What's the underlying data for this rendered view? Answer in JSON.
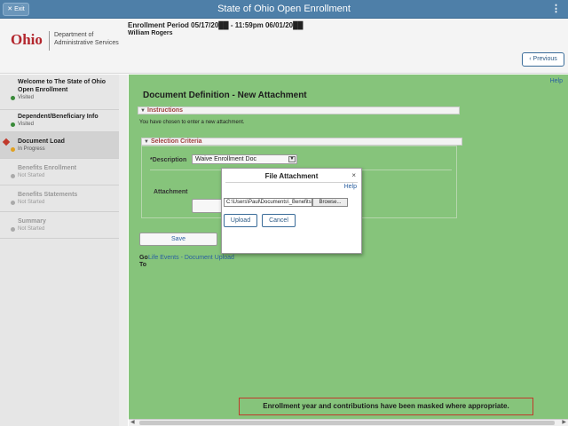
{
  "topbar": {
    "exit_label": "Exit",
    "exit_icon": "close-icon",
    "title": "State of Ohio Open Enrollment",
    "menu_icon": "vertical-ellipsis-icon"
  },
  "header": {
    "logo_word": "Ohio",
    "logo_dept_line1": "Department of",
    "logo_dept_line2": "Administrative Services",
    "enrollment_period": "Enrollment Period 05/17/20██ - 11:59pm 06/01/20██",
    "member_name": "William Rogers",
    "previous_label": "Previous",
    "previous_icon": "chevron-left-icon"
  },
  "sidebar": {
    "items": [
      {
        "label": "Welcome to The State of Ohio Open Enrollment",
        "status": "Visited",
        "status_color": "#3a8a3a"
      },
      {
        "label": "Dependent/Beneficiary Info",
        "status": "Visited",
        "status_color": "#3a8a3a"
      },
      {
        "label": "Document Load",
        "status": "In Progress",
        "status_color": "#e0a020"
      },
      {
        "label": "Benefits Enrollment",
        "status": "Not Started",
        "status_color": "#aaaaaa"
      },
      {
        "label": "Benefits Statements",
        "status": "Not Started",
        "status_color": "#aaaaaa"
      },
      {
        "label": "Summary",
        "status": "Not Started",
        "status_color": "#aaaaaa"
      }
    ]
  },
  "main": {
    "help": "Help",
    "heading": "Document Definition - New Attachment",
    "instructions_header": "Instructions",
    "instructions_text": "You have chosen to enter a new attachment.",
    "criteria_header": "Selection Criteria",
    "description_label": "*Description",
    "description_value": "Waive Enrollment Doc",
    "attachment_label": "Attachment",
    "save_label": "Save",
    "goto_label": "Go To",
    "goto_link": "Life Events - Document Upload",
    "notice": "Enrollment year and contributions have been masked where appropriate."
  },
  "modal": {
    "title": "File Attachment",
    "close": "×",
    "help": "Help",
    "file_path": "C:\\Users\\Paul\\Documents\\_Benefits",
    "browse_label": "Browse...",
    "upload_label": "Upload",
    "cancel_label": "Cancel"
  },
  "colors": {
    "topbar": "#4e7fa8",
    "main_background": "#86c47b",
    "section_title": "#a04040",
    "link": "#2a5fa0",
    "notice_border": "#c0392b"
  }
}
